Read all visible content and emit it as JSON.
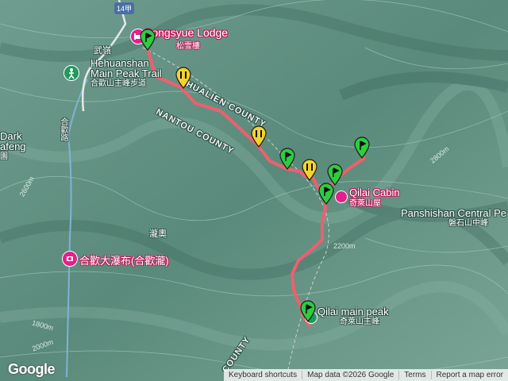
{
  "map": {
    "poi": {
      "lodge": {
        "name": "Songsyue Lodge",
        "name_zh": "松雪樓"
      },
      "trail": {
        "name_line1": "Hehuanshan",
        "name_line2": "Main Peak Trail",
        "name_zh": "合歡山主峰步道"
      },
      "cabin": {
        "name": "Qilai Cabin",
        "name_zh": "奇萊山屋"
      },
      "peak": {
        "name": "Qilai main peak",
        "name_zh": "奇萊山主峰"
      },
      "waterfall": {
        "name_zh": "合歡大瀑布(合歡瀧)"
      },
      "panshishan": {
        "name": "Panshishan Central Pe",
        "name_zh": "磐石山中峰"
      },
      "dark": {
        "line1": "Dark",
        "line2": "afeng",
        "line3": "園"
      }
    },
    "road_shield": "14甲",
    "places": {
      "wuling": "武嶺",
      "taoao": "瀧奧",
      "road_vertical": "合歡路"
    },
    "counties": {
      "hualien": "HUALIEN COUNTY",
      "nantou": "NANTOU COUNTY",
      "nantou_bottom": "COUNTY"
    },
    "contours": [
      "2800m",
      "2600m",
      "2200m",
      "2000m",
      "1800m"
    ],
    "colors": {
      "route": "#ef5f6f",
      "pin_green": "#2ecc40",
      "pin_yellow": "#f2d22e",
      "poi_pink": "#e4208c",
      "poi_green": "#1e9a5a"
    },
    "icons": [
      "lodge-icon",
      "trail-icon",
      "cabin-icon",
      "peak-icon",
      "waterfall-icon",
      "road-shield-icon"
    ]
  },
  "attribution": {
    "logo": "Google",
    "shortcuts": "Keyboard shortcuts",
    "map_data": "Map data ©2026 Google",
    "terms": "Terms",
    "report": "Report a map error"
  }
}
